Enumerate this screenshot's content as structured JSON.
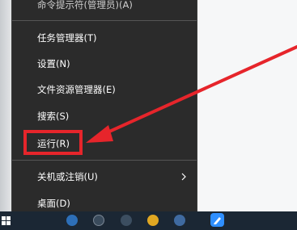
{
  "context_menu": {
    "partial_top_item": "命令提示符(管理员)(A)",
    "items": [
      {
        "label": "任务管理器(T)"
      },
      {
        "label": "设置(N)"
      },
      {
        "label": "文件资源管理器(E)"
      },
      {
        "label": "搜索(S)"
      },
      {
        "label": "运行(R)"
      },
      {
        "label": "关机或注销(U)",
        "has_submenu": true
      },
      {
        "label": "桌面(D)"
      }
    ]
  },
  "annotation": {
    "highlight_color": "#e6252b",
    "arrow_color": "#e6252b"
  },
  "icons": {
    "start": "windows-start-icon",
    "submenu": "chevron-right-icon",
    "notes": "sticky-notes-icon"
  }
}
